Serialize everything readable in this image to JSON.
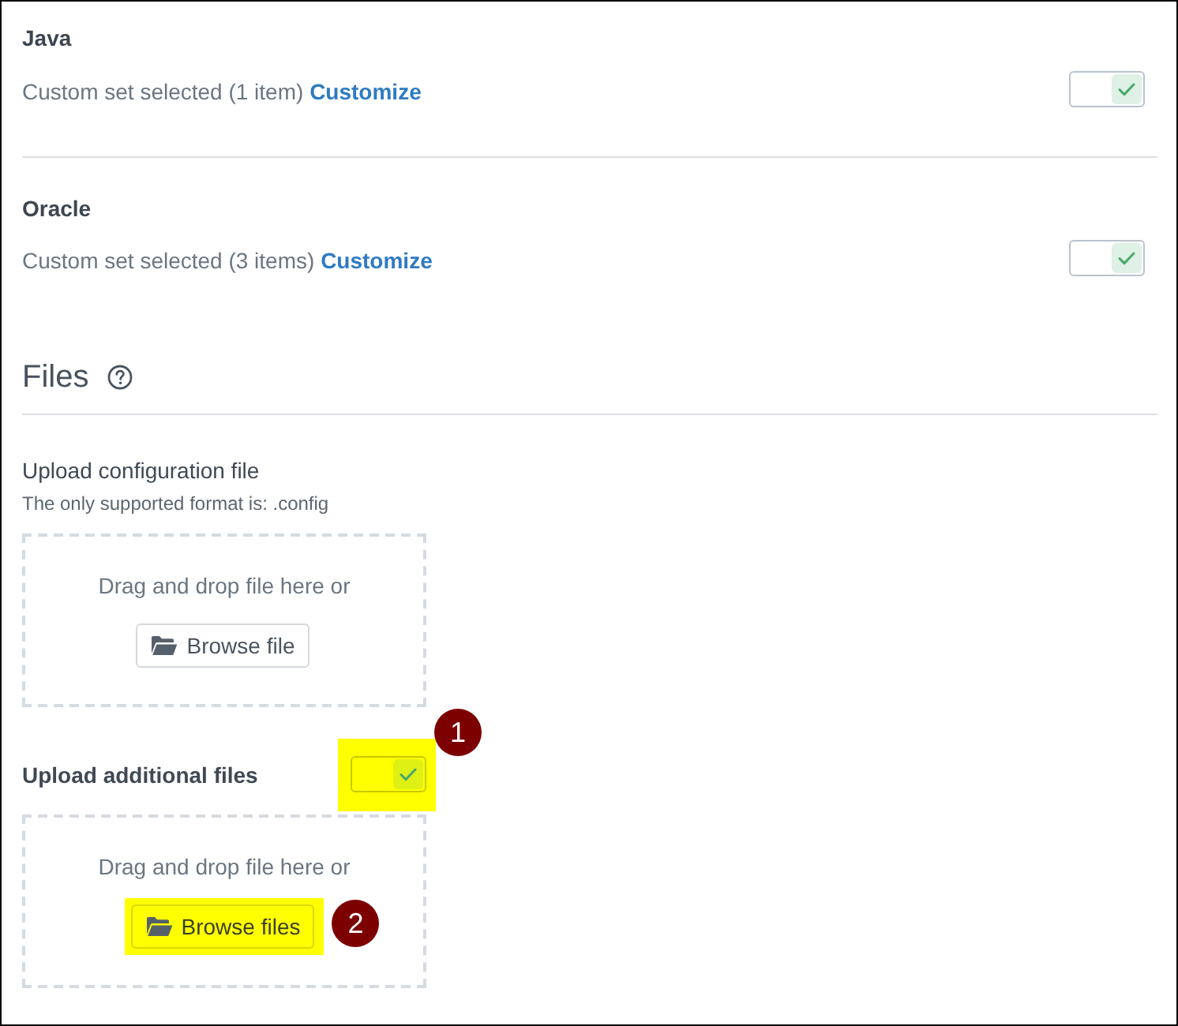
{
  "sections": [
    {
      "title": "Java",
      "description": "Custom set selected (1 item)",
      "link": "Customize",
      "toggle": {
        "on": true
      }
    },
    {
      "title": "Oracle",
      "description": "Custom set selected (3 items)",
      "link": "Customize",
      "toggle": {
        "on": true
      }
    }
  ],
  "files": {
    "heading": "Files",
    "uploads": [
      {
        "kind": "config",
        "label": "Upload configuration file",
        "hint": "The only supported format is: .config",
        "dropzone": {
          "prompt": "Drag and drop file here or",
          "button": {
            "label": "Browse file",
            "highlighted": false
          }
        }
      },
      {
        "kind": "additional",
        "label": "Upload additional files",
        "toggle": {
          "on": true,
          "highlighted": true,
          "callout": "1"
        },
        "dropzone": {
          "prompt": "Drag and drop file here or",
          "button": {
            "label": "Browse files",
            "highlighted": true,
            "callout": "2"
          }
        }
      }
    ]
  }
}
